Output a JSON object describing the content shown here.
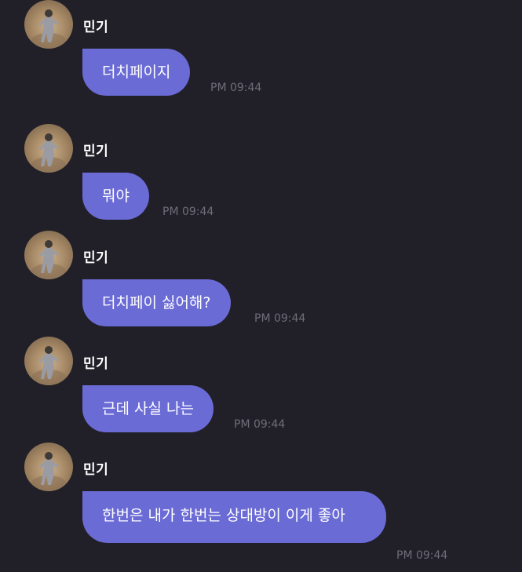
{
  "messages": [
    {
      "sender": "민기",
      "text": "더치페이지",
      "time": "PM 09:44",
      "avatar_icon": "profile-photo"
    },
    {
      "sender": "민기",
      "text": "뭐야",
      "time": "PM 09:44",
      "avatar_icon": "profile-photo"
    },
    {
      "sender": "민기",
      "text": "더치페이 싫어해?",
      "time": "PM 09:44",
      "avatar_icon": "profile-photo"
    },
    {
      "sender": "민기",
      "text": "근데 사실 나는",
      "time": "PM 09:44",
      "avatar_icon": "profile-photo"
    },
    {
      "sender": "민기",
      "text": "한번은 내가 한번는 상대방이 이게 좋아",
      "time": "PM 09:44",
      "avatar_icon": "profile-photo"
    }
  ],
  "colors": {
    "background": "#212028",
    "bubble": "#6b6bd6",
    "timestamp": "#6f6e78",
    "text": "#ffffff"
  }
}
